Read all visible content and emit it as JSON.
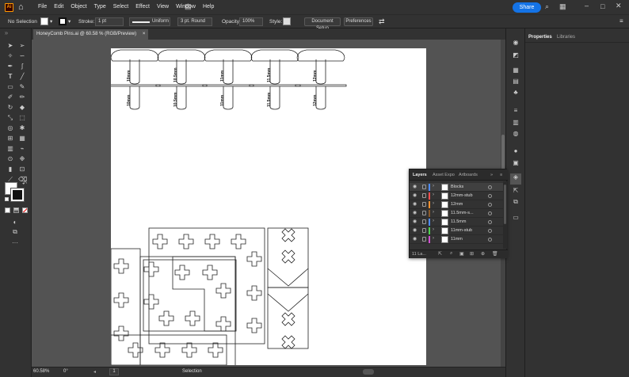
{
  "app": {
    "logo_text": "Ai",
    "menus": [
      "File",
      "Edit",
      "Object",
      "Type",
      "Select",
      "Effect",
      "View",
      "Window",
      "Help"
    ],
    "share_label": "Share"
  },
  "control": {
    "selection_label": "No Selection",
    "stroke_label": "Stroke:",
    "stroke_weight": "1 pt",
    "stroke_profile": "Uniform",
    "brush": "3 pt. Round",
    "opacity_label": "Opacity:",
    "opacity_value": "100%",
    "style_label": "Style:",
    "doc_setup_label": "Document Setup",
    "preferences_label": "Preferences"
  },
  "document": {
    "tab_title": "HoneyComb Pins.ai @ 60.58 % (RGB/Preview)",
    "close_glyph": "×",
    "pin_labels": [
      "10mm",
      "10.5mm",
      "11mm",
      "11.5mm",
      "12mm"
    ],
    "stub_labels": [
      "10mm",
      "10.5mm",
      "11mm",
      "11.5mm",
      "12mm"
    ]
  },
  "status": {
    "zoom": "60.58%",
    "rotation": "0°",
    "artboard_num": "1",
    "tool": "Selection"
  },
  "props_panel": {
    "tab_properties": "Properties",
    "tab_libraries": "Libraries"
  },
  "layers_panel": {
    "tab_layers": "Layers",
    "tab_asset": "Asset Expo",
    "tab_artboards": "Artboards",
    "count_label": "11 La...",
    "rows": [
      {
        "name": "Blocks",
        "color": "#4f8cff",
        "selected": true
      },
      {
        "name": "12mm-stub",
        "color": "#ff4f4f",
        "selected": false
      },
      {
        "name": "12mm",
        "color": "#f09030",
        "selected": false
      },
      {
        "name": "11.5mm-s...",
        "color": "#8a5a2b",
        "selected": false
      },
      {
        "name": "11.5mm",
        "color": "#4f8cff",
        "selected": false
      },
      {
        "name": "11mm-stub",
        "color": "#4fd04f",
        "selected": false
      },
      {
        "name": "11mm",
        "color": "#d04fd0",
        "selected": false
      }
    ]
  },
  "colors": {
    "accent": "#1473e6",
    "chrome_dark": "#323232",
    "canvas_bg": "#535353"
  }
}
